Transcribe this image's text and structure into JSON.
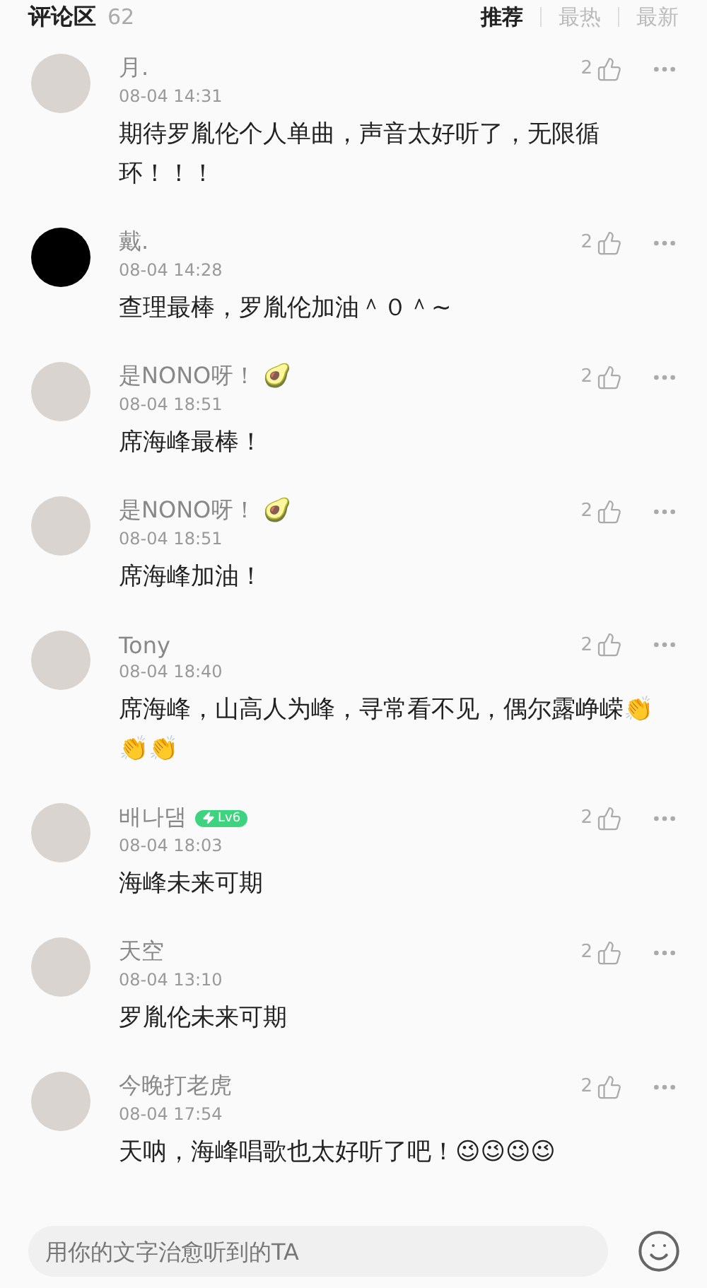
{
  "header": {
    "title": "评论区",
    "count": "62",
    "sort_tabs": [
      {
        "label": "推荐",
        "selected": true
      },
      {
        "label": "最热",
        "selected": false
      },
      {
        "label": "最新",
        "selected": false
      }
    ]
  },
  "comments": [
    {
      "name": "月.",
      "time": "08-04 14:31",
      "text": "期待罗胤伦个人单曲，声音太好听了，无限循环！！！",
      "likes": "2"
    },
    {
      "name": "戴.",
      "time": "08-04 14:28",
      "text": "查理最棒，罗胤伦加油＾０＾~",
      "likes": "2"
    },
    {
      "name": "是NONO呀！ 🥑",
      "time": "08-04 18:51",
      "text": "席海峰最棒！",
      "likes": "2"
    },
    {
      "name": "是NONO呀！ 🥑",
      "time": "08-04 18:51",
      "text": "席海峰加油！",
      "likes": "2"
    },
    {
      "name": "Tony",
      "time": "08-04 18:40",
      "text": "席海峰，山高人为峰，寻常看不见，偶尔露峥嵘👏👏👏",
      "likes": "2"
    },
    {
      "name": "배나댐",
      "badge": "Lv6",
      "time": "08-04 18:03",
      "text": "海峰未来可期",
      "likes": "2"
    },
    {
      "name": "天空",
      "time": "08-04 13:10",
      "text": "罗胤伦未来可期",
      "likes": "2"
    },
    {
      "name": "今晚打老虎",
      "time": "08-04 17:54",
      "text": "天呐，海峰唱歌也太好听了吧！😉😉😉😉",
      "likes": "2"
    }
  ],
  "composer": {
    "placeholder": "用你的文字治愈听到的TA"
  }
}
